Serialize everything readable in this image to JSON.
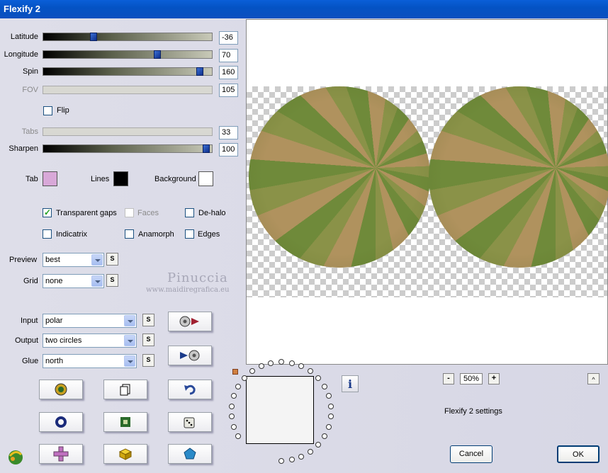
{
  "window": {
    "title": "Flexify 2"
  },
  "sliders": [
    {
      "label": "Latitude",
      "value": "-36",
      "enabled": true,
      "fraction": 0.31
    },
    {
      "label": "Longitude",
      "value": "70",
      "enabled": true,
      "fraction": 0.69
    },
    {
      "label": "Spin",
      "value": "160",
      "enabled": true,
      "fraction": 0.94
    },
    {
      "label": "FOV",
      "value": "105",
      "enabled": false
    },
    {
      "label": "Tabs",
      "value": "33",
      "enabled": false
    },
    {
      "label": "Sharpen",
      "value": "100",
      "enabled": true,
      "fraction": 0.98
    }
  ],
  "flip": {
    "label": "Flip",
    "checked": false
  },
  "colors": {
    "tab": {
      "label": "Tab",
      "color": "#d8a8d8"
    },
    "lines": {
      "label": "Lines",
      "color": "#000000"
    },
    "background": {
      "label": "Background",
      "color": "#ffffff"
    }
  },
  "options": {
    "transparent_gaps": {
      "label": "Transparent gaps",
      "checked": true
    },
    "faces": {
      "label": "Faces",
      "checked": false,
      "enabled": false
    },
    "de_halo": {
      "label": "De-halo",
      "checked": false
    },
    "indicatrix": {
      "label": "Indicatrix",
      "checked": false
    },
    "anamorph": {
      "label": "Anamorph",
      "checked": false
    },
    "edges": {
      "label": "Edges",
      "checked": false
    }
  },
  "dropdowns": {
    "preview": {
      "label": "Preview",
      "value": "best"
    },
    "grid": {
      "label": "Grid",
      "value": "none"
    },
    "input": {
      "label": "Input",
      "value": "polar"
    },
    "output": {
      "label": "Output",
      "value": "two circles"
    },
    "glue": {
      "label": "Glue",
      "value": "north"
    }
  },
  "s_button_label": "S",
  "watermark": {
    "name": "Pinuccia",
    "site": "www.maidiregrafica.eu"
  },
  "zoom": {
    "minus": "-",
    "value": "50%",
    "plus": "+"
  },
  "scroll_up": "^",
  "settings_name": "Flexify 2 settings",
  "buttons": {
    "cancel": "Cancel",
    "ok": "OK"
  },
  "icons": {
    "info": "info-icon",
    "globe_to_flat": "globe-convert-icon",
    "flat_to_globe": "flat-convert-icon"
  }
}
